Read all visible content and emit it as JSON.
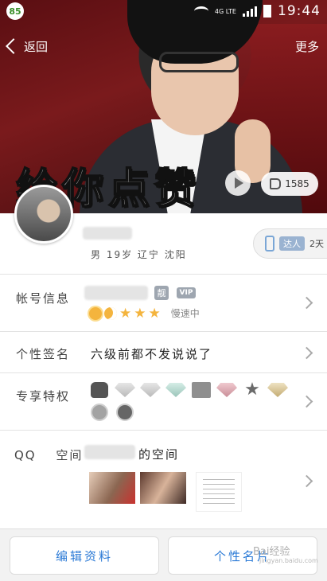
{
  "statusbar": {
    "badge": "85",
    "network": "4G LTE",
    "time": "19:44"
  },
  "topbar": {
    "back_label": "返回",
    "more_label": "更多"
  },
  "cover": {
    "caption": "给你点赞",
    "like_count": "1585"
  },
  "profile": {
    "meta": "男 19岁 辽宁 沈阳",
    "talent_label": "达人",
    "talent_days": "2天"
  },
  "account": {
    "label": "帐号信息",
    "liang": "靓",
    "vip": "VIP",
    "speed": "慢速中"
  },
  "signature": {
    "label": "个性签名",
    "text": "六级前都不发说说了"
  },
  "privileges": {
    "label": "专享特权"
  },
  "space": {
    "label_qq": "QQ",
    "label_space": "空间",
    "suffix": "的空间"
  },
  "buttons": {
    "edit": "编辑资料",
    "personalize": "个性名片"
  },
  "watermark": {
    "text": "Bai经验",
    "url": "jingyan.baidu.com"
  }
}
